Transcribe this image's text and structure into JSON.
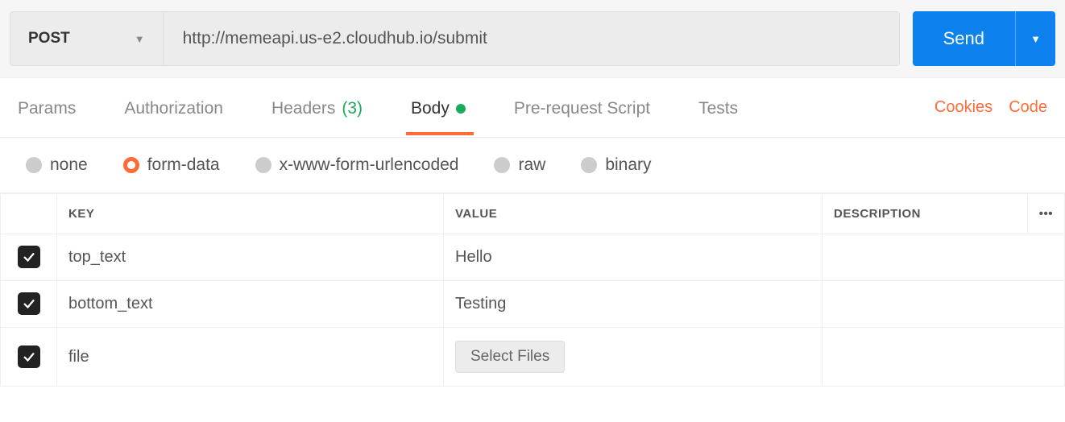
{
  "request": {
    "method": "POST",
    "url": "http://memeapi.us-e2.cloudhub.io/submit",
    "send_label": "Send"
  },
  "tabs": {
    "params": "Params",
    "authorization": "Authorization",
    "headers": "Headers",
    "headers_count": "(3)",
    "body": "Body",
    "prerequest": "Pre-request Script",
    "tests": "Tests"
  },
  "links": {
    "cookies": "Cookies",
    "code": "Code"
  },
  "body_types": {
    "none": "none",
    "form_data": "form-data",
    "urlencoded": "x-www-form-urlencoded",
    "raw": "raw",
    "binary": "binary",
    "selected": "form-data"
  },
  "table": {
    "headers": {
      "key": "KEY",
      "value": "VALUE",
      "description": "DESCRIPTION"
    },
    "rows": [
      {
        "checked": true,
        "key": "top_text",
        "value": "Hello",
        "description": ""
      },
      {
        "checked": true,
        "key": "bottom_text",
        "value": "Testing",
        "description": ""
      },
      {
        "checked": true,
        "key": "file",
        "value": "",
        "value_is_file": true,
        "file_button_label": "Select Files",
        "description": ""
      }
    ]
  }
}
